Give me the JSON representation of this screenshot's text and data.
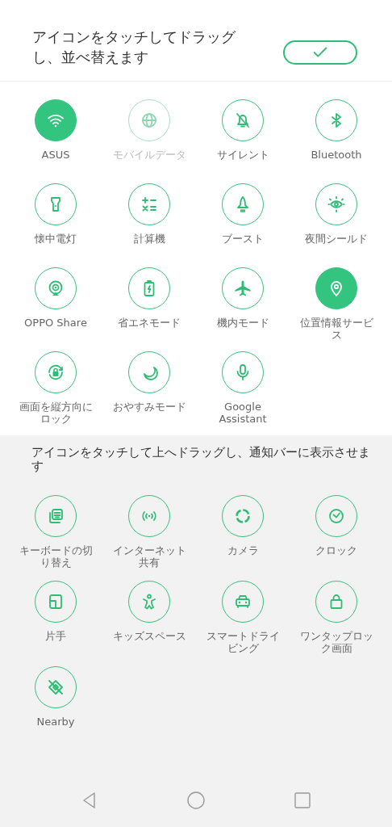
{
  "header": {
    "instruction": "アイコンをタッチしてドラッグし、並べ替えます"
  },
  "active_tiles": [
    {
      "label": "ASUS",
      "kind": "wifi",
      "on": true,
      "disabled": false
    },
    {
      "label": "モバイルデータ",
      "kind": "globe",
      "on": false,
      "disabled": true
    },
    {
      "label": "サイレント",
      "kind": "bell-off",
      "on": false,
      "disabled": false
    },
    {
      "label": "Bluetooth",
      "kind": "bluetooth",
      "on": false,
      "disabled": false
    },
    {
      "label": "懐中電灯",
      "kind": "flashlight",
      "on": false,
      "disabled": false
    },
    {
      "label": "計算機",
      "kind": "calculator",
      "on": false,
      "disabled": false
    },
    {
      "label": "ブースト",
      "kind": "rocket",
      "on": false,
      "disabled": false
    },
    {
      "label": "夜間シールド",
      "kind": "eye",
      "on": false,
      "disabled": false
    },
    {
      "label": "OPPO Share",
      "kind": "share",
      "on": false,
      "disabled": false
    },
    {
      "label": "省エネモード",
      "kind": "battery",
      "on": false,
      "disabled": false
    },
    {
      "label": "機内モード",
      "kind": "airplane",
      "on": false,
      "disabled": false
    },
    {
      "label": "位置情報サービス",
      "kind": "pin",
      "on": true,
      "disabled": false
    },
    {
      "label": "画面を縦方向にロック",
      "kind": "rotate-lock",
      "on": false,
      "disabled": false
    },
    {
      "label": "おやすみモード",
      "kind": "moon",
      "on": false,
      "disabled": false
    },
    {
      "label": "Google Assistant",
      "kind": "mic",
      "on": false,
      "disabled": false
    }
  ],
  "available": {
    "instruction": "アイコンをタッチして上へドラッグし、通知バーに表示させます",
    "tiles": [
      {
        "label": "キーボードの切り替え",
        "kind": "keyboard"
      },
      {
        "label": "インターネット共有",
        "kind": "broadcast"
      },
      {
        "label": "カメラ",
        "kind": "ring"
      },
      {
        "label": "クロック",
        "kind": "clock"
      },
      {
        "label": "片手",
        "kind": "one-hand"
      },
      {
        "label": "キッズスペース",
        "kind": "kid"
      },
      {
        "label": "スマートドライビング",
        "kind": "car"
      },
      {
        "label": "ワンタップロック画面",
        "kind": "lock"
      },
      {
        "label": "Nearby",
        "kind": "nearby"
      }
    ]
  }
}
